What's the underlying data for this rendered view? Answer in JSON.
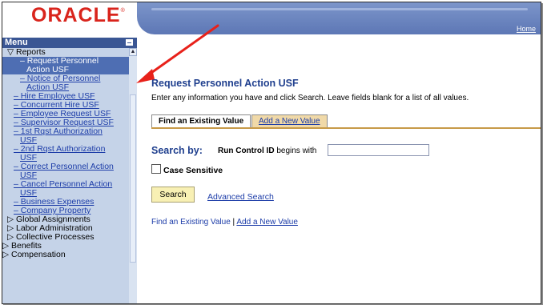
{
  "brand": {
    "logo_text": "ORACLE",
    "logo_mark": "®"
  },
  "header": {
    "home_link": "Home"
  },
  "menu": {
    "title": "Menu",
    "items": [
      {
        "label": "▽ Reports"
      },
      {
        "label": "– Request Personnel"
      },
      {
        "label": "Action USF"
      },
      {
        "label": "– Notice of Personnel"
      },
      {
        "label": "Action USF"
      },
      {
        "label": "– Hire Employee USF"
      },
      {
        "label": "– Concurrent Hire USF"
      },
      {
        "label": "– Employee Request USF"
      },
      {
        "label": "– Supervisor Request USF"
      },
      {
        "label": "– 1st Rqst Authorization"
      },
      {
        "label": "USF"
      },
      {
        "label": "– 2nd Rqst Authorization"
      },
      {
        "label": "USF"
      },
      {
        "label": "– Correct Personnel Action"
      },
      {
        "label": "USF"
      },
      {
        "label": "– Cancel Personnel Action"
      },
      {
        "label": "USF"
      },
      {
        "label": "– Business Expenses"
      },
      {
        "label": "– Company Property"
      },
      {
        "label": "▷ Global Assignments"
      },
      {
        "label": "▷ Labor Administration"
      },
      {
        "label": "▷ Collective Processes"
      },
      {
        "label": "▷ Benefits"
      },
      {
        "label": "▷ Compensation"
      }
    ]
  },
  "main": {
    "title": "Request Personnel Action USF",
    "instructions": "Enter any information you have and click Search. Leave fields blank for a list of all values.",
    "tabs": [
      {
        "label": "Find an Existing Value"
      },
      {
        "label": "Add a New Value"
      }
    ],
    "search_by_label": "Search by:",
    "run_control_label": "Run Control ID",
    "begins_with": "begins with",
    "run_control_value": "",
    "case_sensitive_label": "Case Sensitive",
    "search_button": "Search",
    "advanced_search": "Advanced Search",
    "bottom_find": "Find an Existing Value",
    "bottom_sep": "|",
    "bottom_add": "Add a New Value"
  },
  "colors": {
    "brand_red": "#d9241c",
    "header_blue": "#5d77b5",
    "menu_bg": "#c5d3e8",
    "selected_bg": "#4e6eb3",
    "title_blue": "#1f3f8e",
    "link_blue": "#1c3ca8",
    "tab_orange": "#f0d9a8",
    "button_yellow": "#f8f0b4",
    "arrow_red": "#e8211a"
  }
}
